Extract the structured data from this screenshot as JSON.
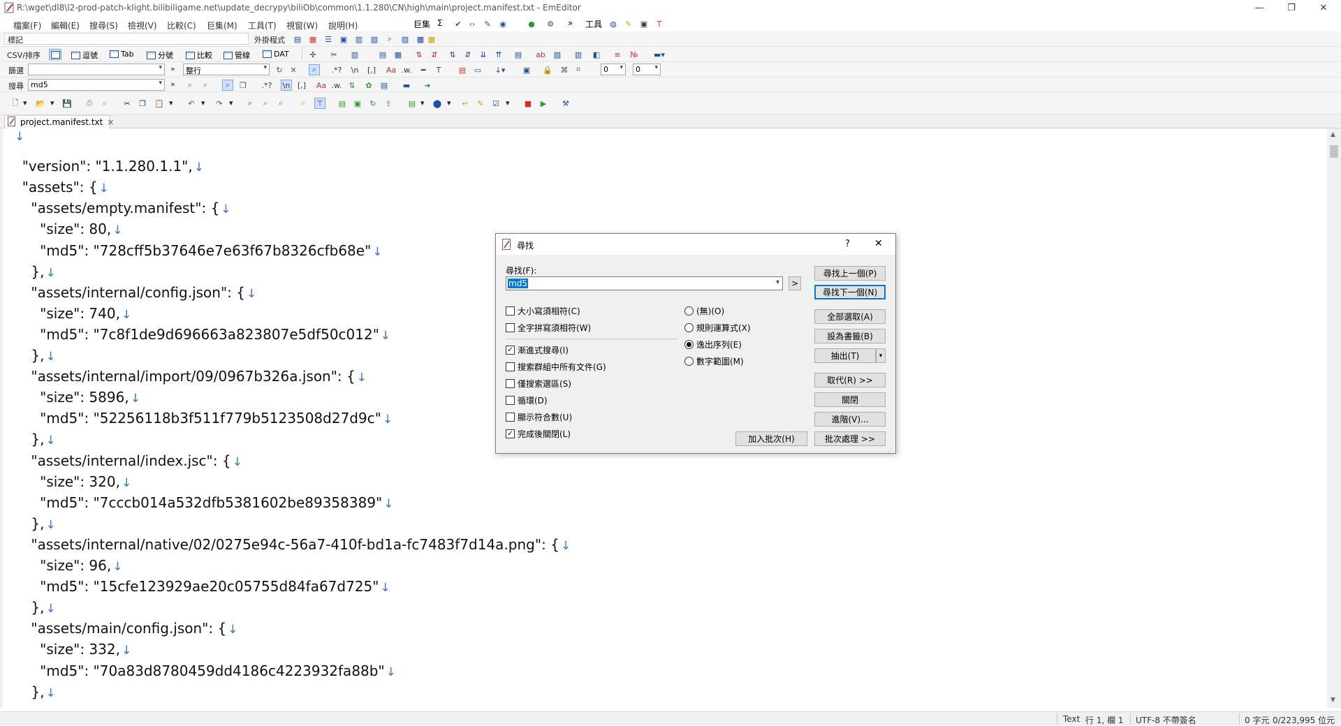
{
  "window": {
    "title": "R:\\wget\\dl8\\l2-prod-patch-klight.bilibiligame.net\\update_decrypy\\biliOb\\common\\1.1.280\\CN\\high\\main\\project.manifest.txt - EmEditor",
    "minimize": "—",
    "restore": "❐",
    "close": "✕"
  },
  "menubar": {
    "items": [
      "檔案(F)",
      "編輯(E)",
      "搜尋(S)",
      "檢視(V)",
      "比較(C)",
      "巨集(M)",
      "工具(T)",
      "視窗(W)",
      "說明(H)"
    ],
    "macros_label": "巨集",
    "sigma": "Σ",
    "tools_label": "工具",
    "more": "»"
  },
  "toolbars": {
    "bookmark_label": "標記",
    "external_label": "外掛程式",
    "csv_label": "CSV/排序",
    "csv_buttons": [
      "逗號",
      "Tab",
      "分號",
      "比較",
      "管線",
      "DAT"
    ],
    "filter_label": "篩選",
    "filter_value": "",
    "filter_mode": "整行",
    "filter_num1": "0",
    "filter_num2": "0",
    "search_label": "搜尋",
    "search_value": "md5"
  },
  "tab": {
    "filename": "project.manifest.txt",
    "close": "×"
  },
  "editor": {
    "lines": [
      "",
      "  \"version\": \"1.1.280.1.1\",",
      "  \"assets\": {",
      "    \"assets/empty.manifest\": {",
      "      \"size\": 80,",
      "      \"md5\": \"728cff5b37646e7e63f67b8326cfb68e\"",
      "    },",
      "    \"assets/internal/config.json\": {",
      "      \"size\": 740,",
      "      \"md5\": \"7c8f1de9d696663a823807e5df50c012\"",
      "    },",
      "    \"assets/internal/import/09/0967b326a.json\": {",
      "      \"size\": 5896,",
      "      \"md5\": \"52256118b3f511f779b5123508d27d9c\"",
      "    },",
      "    \"assets/internal/index.jsc\": {",
      "      \"size\": 320,",
      "      \"md5\": \"7cccb014a532dfb5381602be89358389\"",
      "    },",
      "    \"assets/internal/native/02/0275e94c-56a7-410f-bd1a-fc7483f7d14a.png\": {",
      "      \"size\": 96,",
      "      \"md5\": \"15cfe123929ae20c05755d84fa67d725\"",
      "    },",
      "    \"assets/main/config.json\": {",
      "      \"size\": 332,",
      "      \"md5\": \"70a83d8780459dd4186c4223932fa88b\"",
      "    },"
    ],
    "newline_marker": "↓"
  },
  "statusbar": {
    "mode": "Text",
    "position": "行 1, 欄 1",
    "encoding": "UTF-8 不帶簽名",
    "chars": "0 字元",
    "size": "0/223,995 位元"
  },
  "dialog": {
    "title": "尋找",
    "help": "?",
    "close": "✕",
    "find_label": "尋找(F):",
    "find_value": "md5",
    "more": ">",
    "checkboxes": [
      {
        "label": "大小寫須相符(C)",
        "checked": false
      },
      {
        "label": "全字拼寫須相符(W)",
        "checked": false
      },
      {
        "label": "漸進式搜尋(I)",
        "checked": true
      },
      {
        "label": "搜索群組中所有文件(G)",
        "checked": false
      },
      {
        "label": "僅搜索選區(S)",
        "checked": false
      },
      {
        "label": "循環(D)",
        "checked": false
      },
      {
        "label": "顯示符合數(U)",
        "checked": false
      },
      {
        "label": "完成後關閉(L)",
        "checked": true
      }
    ],
    "radios": [
      {
        "label": "(無)(O)",
        "selected": false
      },
      {
        "label": "規則運算式(X)",
        "selected": false
      },
      {
        "label": "逸出序列(E)",
        "selected": true
      },
      {
        "label": "數字範圍(M)",
        "selected": false
      }
    ],
    "buttons": {
      "find_prev": "尋找上一個(P)",
      "find_next": "尋找下一個(N)",
      "select_all": "全部選取(A)",
      "bookmark": "設為書籤(B)",
      "extract": "抽出(T)",
      "replace": "取代(R) >>",
      "close": "關閉",
      "advanced": "進階(V)...",
      "add_batch": "加入批次(H)",
      "batch": "批次處理 >>"
    }
  }
}
